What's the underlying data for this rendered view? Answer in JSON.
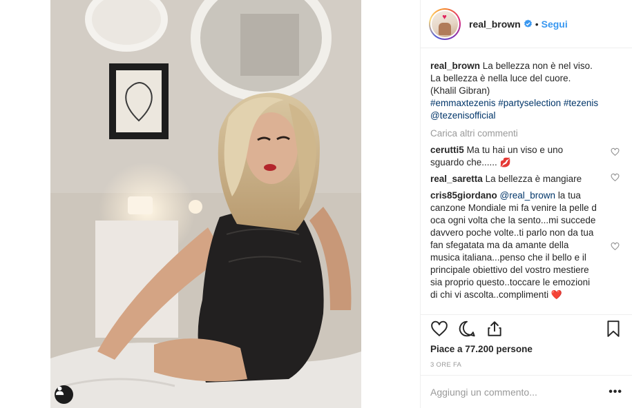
{
  "post": {
    "username": "real_brown",
    "follow_separator": "•",
    "follow_label": "Segui",
    "caption": {
      "user": "real_brown",
      "line1": "La bellezza non è nel viso.",
      "line2": "La bellezza è nella luce del cuore.",
      "line3": "(Khalil Gibran)",
      "tags_line1": "#emmaxtezenis #partyselection #tezenis",
      "tags_line2": "@tezenisofficial"
    },
    "load_more_label": "Carica altri commenti",
    "comments": [
      {
        "user": "cerutti5",
        "text": "Ma tu hai un viso e uno sguardo che......",
        "emoji": "💋"
      },
      {
        "user": "real_saretta",
        "text": "La bellezza è mangiare"
      },
      {
        "user": "cris85giordano",
        "mention": "@real_brown",
        "text": "la tua canzone Mondiale mi fa venire la pelle d oca ogni volta che la sento...mi succede davvero poche volte..ti parlo non da tua fan sfegatata ma da amante della musica italiana...penso che il bello e il principale obiettivo del vostro mestiere sia proprio questo..toccare le emozioni di chi vi ascolta..complimenti",
        "emoji": "❤️"
      }
    ],
    "likes": "Piace a 77.200 persone",
    "time_ago": "3 ORE FA",
    "add_comment_placeholder": "Aggiungi un commento...",
    "more_options": "•••"
  },
  "icons": {
    "verified": "verified-badge-icon",
    "like": "heart-icon",
    "comment": "comment-icon",
    "share": "share-icon",
    "save": "bookmark-icon",
    "user_tag": "user-tag-icon"
  },
  "colors": {
    "link_blue": "#3897f0",
    "hashtag": "#003569",
    "muted": "#999999",
    "text": "#262626",
    "border": "#efefef"
  }
}
